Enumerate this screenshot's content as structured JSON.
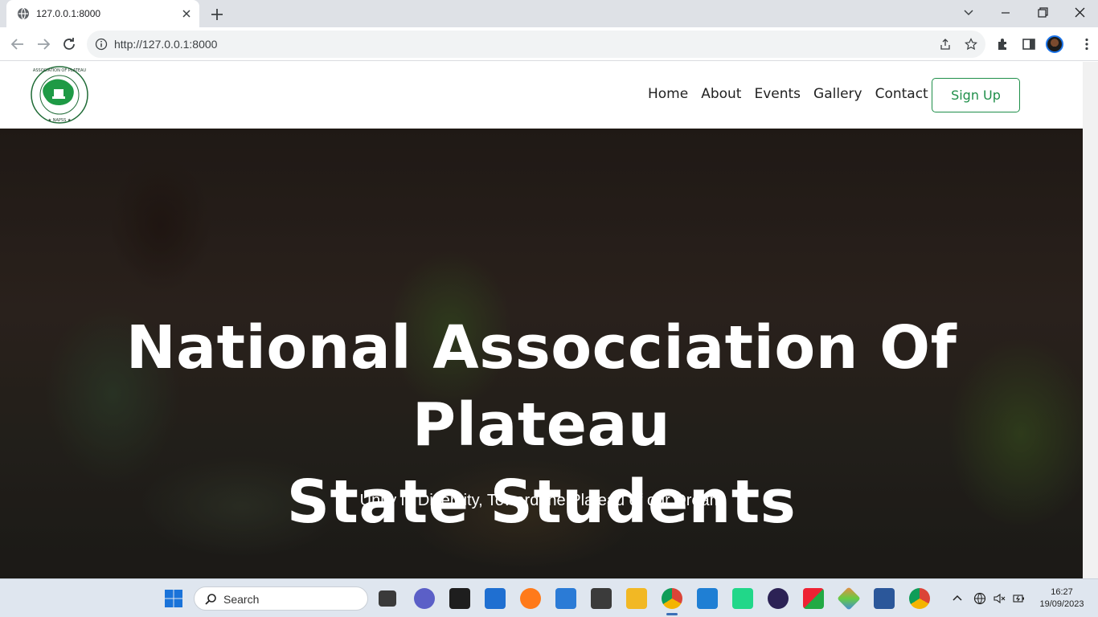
{
  "browser": {
    "tab_title": "127.0.0.1:8000",
    "url": "http://127.0.0.1:8000"
  },
  "site": {
    "logo_alt": "NATIONAL ASSOCIATION OF PLATEAU STATE STUDENTS NAPSS",
    "nav": [
      {
        "label": "Home"
      },
      {
        "label": "About"
      },
      {
        "label": "Events"
      },
      {
        "label": "Gallery"
      },
      {
        "label": "Contact"
      }
    ],
    "signup_label": "Sign Up",
    "hero": {
      "title_line1": "National Assocciation Of Plateau",
      "title_line2": "State Students",
      "subtitle": "Unity in Diversity, Toward the Plateau of our Dream"
    },
    "colors": {
      "accent": "#1f8f4a"
    }
  },
  "taskbar": {
    "search_placeholder": "Search",
    "time": "16:27",
    "date": "19/09/2023"
  }
}
